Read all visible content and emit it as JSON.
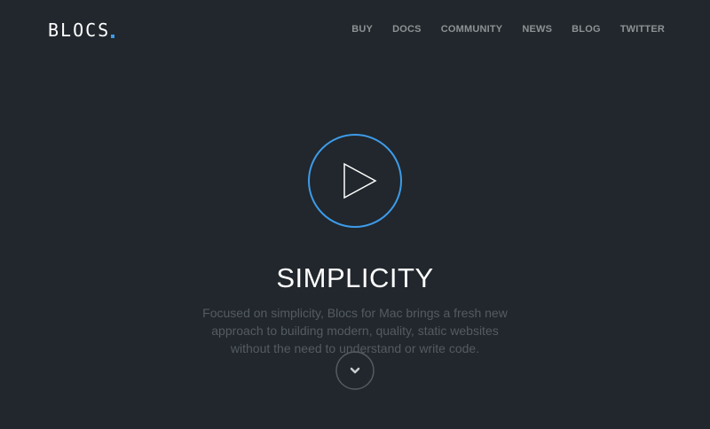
{
  "header": {
    "logo_text": "BLOCS",
    "nav_items": [
      "BUY",
      "DOCS",
      "COMMUNITY",
      "NEWS",
      "BLOG",
      "TWITTER"
    ]
  },
  "hero": {
    "title": "SIMPLICITY",
    "description": "Focused on simplicity, Blocs for Mac brings a fresh new approach to building modern, quality, static websites without the need to understand or write code.",
    "play_icon": "play-icon",
    "scroll_icon": "chevron-down-icon"
  },
  "colors": {
    "background": "#21272c",
    "accent": "#3d9be9",
    "nav_text": "#8d9296",
    "body_text": "#545b61"
  }
}
